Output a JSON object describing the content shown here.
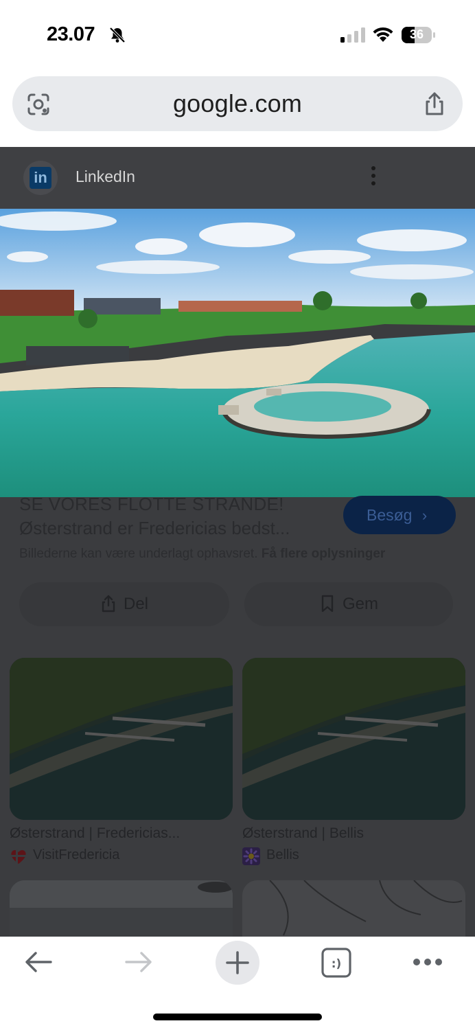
{
  "status_bar": {
    "time": "23.07",
    "battery_level": "36",
    "icons": [
      "bell-slash-icon",
      "signal-icon",
      "wifi-icon",
      "battery-icon"
    ]
  },
  "browser": {
    "url": "google.com",
    "icons": [
      "lens-icon",
      "share-icon"
    ]
  },
  "result": {
    "source_name": "LinkedIn",
    "title_line1": "SE VORES FLOTTE STRANDE!",
    "title_line2": "Østerstrand er Fredericias bedst...",
    "visit_label": "Besøg",
    "copyright_text": "Billederne kan være underlagt ophavsret.",
    "copyright_link": "Få flere oplysninger",
    "share_label": "Del",
    "save_label": "Gem"
  },
  "related": [
    {
      "label": "Østerstrand | Fredericias...",
      "source": "VisitFredericia"
    },
    {
      "label": "Østerstrand | Bellis",
      "source": "Bellis"
    }
  ],
  "toolbar": {
    "icons": [
      "back-arrow-icon",
      "forward-arrow-icon",
      "new-tab-plus-icon",
      "tabs-icon",
      "more-icon"
    ]
  },
  "colors": {
    "accent": "#0b2347",
    "dim_overlay": "#3b3c3f"
  }
}
